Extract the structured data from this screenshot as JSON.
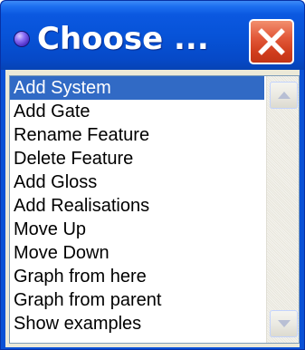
{
  "window": {
    "title": "Choose ..."
  },
  "list": {
    "selected_index": 0,
    "items": [
      "Add System",
      "Add Gate",
      "Rename Feature",
      "Delete Feature",
      "Add Gloss",
      "Add Realisations",
      "Move Up",
      "Move Down",
      "Graph from here",
      "Graph from parent",
      "Show examples"
    ]
  },
  "colors": {
    "titlebar": "#0753d8",
    "close_button": "#d03d1d",
    "selection": "#316ac5"
  },
  "icons": {
    "window_icon": "purple-orb-icon",
    "close": "close-x-icon",
    "scroll_up": "arrow-up-icon",
    "scroll_down": "arrow-down-icon"
  }
}
